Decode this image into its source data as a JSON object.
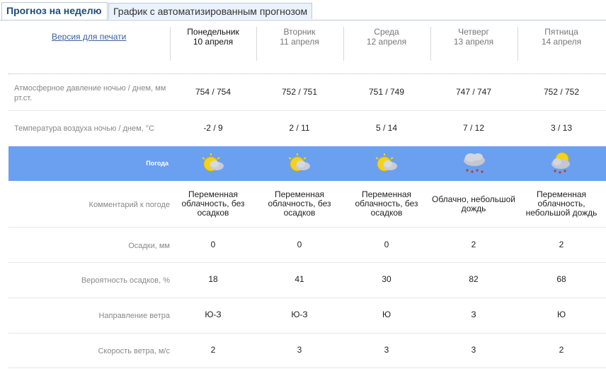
{
  "tabs": {
    "weekly": "Прогноз на неделю",
    "chart": "График с автоматизированным прогнозом"
  },
  "print_link": "Версия для печати",
  "days": [
    {
      "name": "Понедельник",
      "date": "10 апреля",
      "pressure": "754 / 754",
      "temperature": "-2 / 9",
      "weather_icon": "partly-cloudy-icon",
      "comment": "Переменная облачность, без осадков",
      "precip": "0",
      "precip_prob": "18",
      "wind_dir": "Ю-З",
      "wind_speed": "2"
    },
    {
      "name": "Вторник",
      "date": "11 апреля",
      "pressure": "752 / 751",
      "temperature": "2 / 11",
      "weather_icon": "partly-cloudy-icon",
      "comment": "Переменная облачность, без осадков",
      "precip": "0",
      "precip_prob": "41",
      "wind_dir": "Ю-З",
      "wind_speed": "3"
    },
    {
      "name": "Среда",
      "date": "12 апреля",
      "pressure": "751 / 749",
      "temperature": "5 / 14",
      "weather_icon": "partly-cloudy-icon",
      "comment": "Переменная облачность, без осадков",
      "precip": "0",
      "precip_prob": "30",
      "wind_dir": "Ю",
      "wind_speed": "3"
    },
    {
      "name": "Четверг",
      "date": "13 апреля",
      "pressure": "747 / 747",
      "temperature": "7 / 12",
      "weather_icon": "cloud-rain-icon",
      "comment": "Облачно, небольшой дождь",
      "precip": "2",
      "precip_prob": "82",
      "wind_dir": "З",
      "wind_speed": "3"
    },
    {
      "name": "Пятница",
      "date": "14 апреля",
      "pressure": "752 / 752",
      "temperature": "3 / 13",
      "weather_icon": "sun-cloud-rain-icon",
      "comment": "Переменная облачность, небольшой дождь",
      "precip": "2",
      "precip_prob": "68",
      "wind_dir": "Ю",
      "wind_speed": "2"
    }
  ],
  "rows": {
    "pressure": "Атмосферное давление ночью / днем, мм рт.ст.",
    "temperature": "Температура воздуха ночью / днем, °С",
    "weather": "Погода",
    "comment": "Комментарий к погоде",
    "precip": "Осадки, мм",
    "precip_prob": "Вероятность осадков, %",
    "wind_dir": "Направление ветра",
    "wind_speed": "Скорость ветра, м/с"
  },
  "colors": {
    "weather_band": "#6b9ff0",
    "tab_text": "#1f4b7a",
    "link": "#3c5fa0"
  }
}
